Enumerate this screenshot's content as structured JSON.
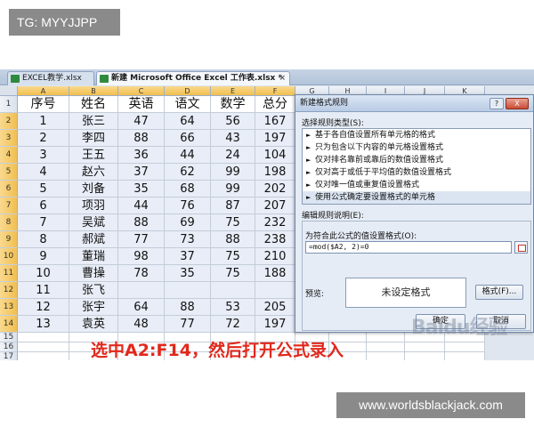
{
  "watermark_top": "TG: MYYJJPP",
  "watermark_bottom": "www.worldsblackjack.com",
  "tabs": [
    {
      "label": "EXCEL教学.xlsx"
    },
    {
      "label": "新建 Microsoft Office Excel 工作表.xlsx *"
    }
  ],
  "columns": [
    "A",
    "B",
    "C",
    "D",
    "E",
    "F",
    "G",
    "H",
    "I",
    "J",
    "K"
  ],
  "rows": [
    "1",
    "2",
    "3",
    "4",
    "5",
    "6",
    "7",
    "8",
    "9",
    "10",
    "11",
    "12",
    "13",
    "14",
    "15",
    "16",
    "17"
  ],
  "table": {
    "headers": [
      "序号",
      "姓名",
      "英语",
      "语文",
      "数学",
      "总分"
    ],
    "rows": [
      [
        "1",
        "张三",
        "47",
        "64",
        "56",
        "167"
      ],
      [
        "2",
        "李四",
        "88",
        "66",
        "43",
        "197"
      ],
      [
        "3",
        "王五",
        "36",
        "44",
        "24",
        "104"
      ],
      [
        "4",
        "赵六",
        "37",
        "62",
        "99",
        "198"
      ],
      [
        "5",
        "刘备",
        "35",
        "68",
        "99",
        "202"
      ],
      [
        "6",
        "项羽",
        "44",
        "76",
        "87",
        "207"
      ],
      [
        "7",
        "吴斌",
        "88",
        "69",
        "75",
        "232"
      ],
      [
        "8",
        "郝斌",
        "77",
        "73",
        "88",
        "238"
      ],
      [
        "9",
        "董瑞",
        "98",
        "37",
        "75",
        "210"
      ],
      [
        "10",
        "曹操",
        "78",
        "35",
        "75",
        "188"
      ],
      [
        "11",
        "张飞",
        "",
        "",
        "",
        ""
      ],
      [
        "12",
        "张宇",
        "64",
        "88",
        "53",
        "205"
      ],
      [
        "13",
        "袁英",
        "48",
        "77",
        "72",
        "197"
      ]
    ]
  },
  "overlay_text": "选中A2:F14，然后打开公式录入",
  "dialog": {
    "title": "新建格式规则",
    "help": "?",
    "close": "X",
    "select_label": "选择规则类型(S):",
    "rule_types": [
      "基于各自值设置所有单元格的格式",
      "只为包含以下内容的单元格设置格式",
      "仅对排名靠前或靠后的数值设置格式",
      "仅对高于或低于平均值的数值设置格式",
      "仅对唯一值或重复值设置格式",
      "使用公式确定要设置格式的单元格"
    ],
    "edit_label": "编辑规则说明(E):",
    "formula_label": "为符合此公式的值设置格式(O):",
    "formula_value": "=mod($A2, 2)=0",
    "preview_label": "预览:",
    "preview_text": "未设定格式",
    "format_button": "格式(F)...",
    "ok_button": "确定",
    "cancel_button": "取消"
  },
  "baidu_watermark": "Baidu经验",
  "colors": {
    "overlay": "#e1281c",
    "selected_header": "#f1bf4f",
    "dialog_bg": "#e6ecf5"
  }
}
